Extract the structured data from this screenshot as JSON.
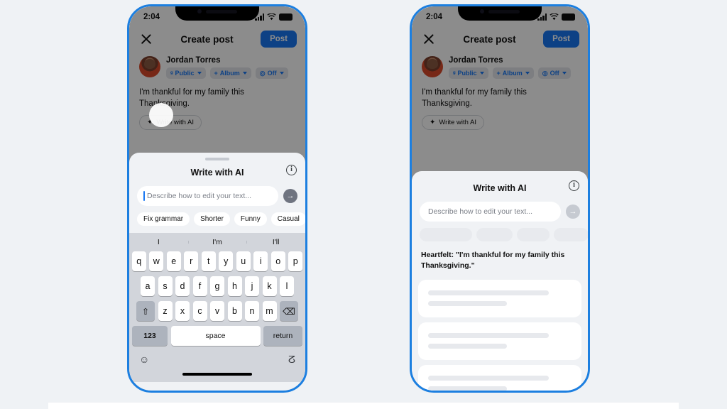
{
  "page": {
    "background_color": "#eff2f5",
    "accent_color": "#1877f2",
    "frame_color": "#1c7fe0"
  },
  "status_bar": {
    "time": "2:04",
    "signal_icon": "cellular-bars-icon",
    "wifi_icon": "wifi-icon",
    "battery_icon": "battery-icon"
  },
  "compose": {
    "close_icon": "close-icon",
    "title": "Create post",
    "post_label": "Post",
    "author": "Jordan Torres",
    "avatar_icon": "avatar",
    "pills": [
      {
        "icon": "globe-icon",
        "glyph": "ᵍ",
        "label": "Public"
      },
      {
        "icon": "plus-icon",
        "glyph": "+",
        "label": "Album"
      },
      {
        "icon": "camera-icon",
        "glyph": "◎",
        "label": "Off"
      }
    ],
    "post_text": "I'm thankful for my family this Thanksgiving.",
    "ai_chip_label": "Write with AI",
    "ai_chip_icon": "sparkle-icon"
  },
  "sheet": {
    "title": "Write with AI",
    "info_icon": "info-circle-icon",
    "info_glyph": "i",
    "input_placeholder": "Describe how to edit your text...",
    "send_icon": "arrow-right-circle-icon",
    "send_glyph": "→",
    "quick_chips": [
      "Fix grammar",
      "Shorter",
      "Funny",
      "Casual"
    ]
  },
  "left_phone": {
    "tap_indicator": "tap-indicator",
    "keyboard": {
      "predictions": [
        "I",
        "I'm",
        "I'll"
      ],
      "row1": [
        "q",
        "w",
        "e",
        "r",
        "t",
        "y",
        "u",
        "i",
        "o",
        "p"
      ],
      "row2": [
        "a",
        "s",
        "d",
        "f",
        "g",
        "h",
        "j",
        "k",
        "l"
      ],
      "row3": [
        "z",
        "x",
        "c",
        "v",
        "b",
        "n",
        "m"
      ],
      "shift_icon": "shift-icon",
      "shift_glyph": "⇧",
      "backspace_icon": "backspace-icon",
      "backspace_glyph": "⌫",
      "numbers_label": "123",
      "space_label": "space",
      "return_label": "return",
      "emoji_icon": "emoji-icon",
      "emoji_glyph": "☺",
      "mic_icon": "microphone-icon",
      "mic_glyph": "ⵒ"
    }
  },
  "right_phone": {
    "result_text": "Heartfelt: \"I'm thankful for my family this Thanksgiving.\"",
    "loading_cards": 3
  }
}
